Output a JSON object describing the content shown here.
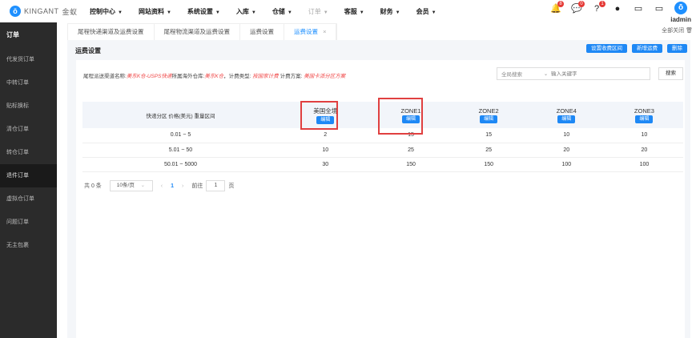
{
  "brand": {
    "name": "KINGANT",
    "sub": "金蚁"
  },
  "nav": [
    {
      "label": "控制中心"
    },
    {
      "label": "网站资料"
    },
    {
      "label": "系统设置"
    },
    {
      "label": "入库"
    },
    {
      "label": "仓储"
    },
    {
      "label": "订单",
      "dim": true
    },
    {
      "label": "客服"
    },
    {
      "label": "财务"
    },
    {
      "label": "会员"
    }
  ],
  "header_icons": [
    {
      "icon": "bell-icon",
      "badge": "8"
    },
    {
      "icon": "message-icon",
      "badge": "0"
    },
    {
      "icon": "help-icon",
      "badge": "1"
    },
    {
      "icon": "globe-icon"
    },
    {
      "icon": "monitor-icon"
    },
    {
      "icon": "screen-icon"
    }
  ],
  "user": {
    "name": "iadmin"
  },
  "sidebar": {
    "title": "订单",
    "items": [
      "代发货订单",
      "中转订单",
      "贴标换标",
      "清仓订单",
      "转仓订单",
      "退件订单",
      "虚拟仓订单",
      "问题订单",
      "无主包裹"
    ],
    "active": "退件订单"
  },
  "tabs": [
    {
      "label": "尾程快递渠道及运费设置"
    },
    {
      "label": "尾程物流渠道及运费设置"
    },
    {
      "label": "运费设置"
    },
    {
      "label": "运费设置",
      "active": true,
      "close": "×"
    }
  ],
  "close_all": "全部关闭",
  "panel": {
    "title": "运费设置",
    "buttons": [
      "设置收费区间",
      "新增运费",
      "删除"
    ]
  },
  "filter": {
    "label1": "尾程派送渠道名称:",
    "value1": "美东K仓-USPS快递",
    "label2": "所属海外仓库:",
    "value2": "美东K仓",
    "sep": "，",
    "label3": "计费类型:",
    "value3": "按国家计费",
    "label4": "计费方案:",
    "value4": "美国卡派分区方案"
  },
  "search": {
    "select": "全局搜索",
    "placeholder": "输入关键字",
    "button": "搜索"
  },
  "table": {
    "first_header": "快递分区 价格(美元) 重量区间",
    "edit_label": "编辑",
    "zones": [
      "美国全境",
      "ZONE1",
      "ZONE2",
      "ZONE4",
      "ZONE3"
    ],
    "rows": [
      {
        "range": "0.01 ~ 5",
        "values": [
          "2",
          "15",
          "15",
          "10",
          "10"
        ]
      },
      {
        "range": "5.01 ~ 50",
        "values": [
          "10",
          "25",
          "25",
          "20",
          "20"
        ]
      },
      {
        "range": "50.01 ~ 5000",
        "values": [
          "30",
          "150",
          "150",
          "100",
          "100"
        ]
      }
    ]
  },
  "pagination": {
    "total": "共 0 条",
    "page_size": "10条/页",
    "prev": "‹",
    "current": "1",
    "next": "›",
    "goto": "前往",
    "goto_value": "1",
    "page_unit": "页"
  },
  "colors": {
    "accent": "#1e88f5",
    "highlight": "#e04040",
    "sidebar": "#2b2b2b"
  }
}
